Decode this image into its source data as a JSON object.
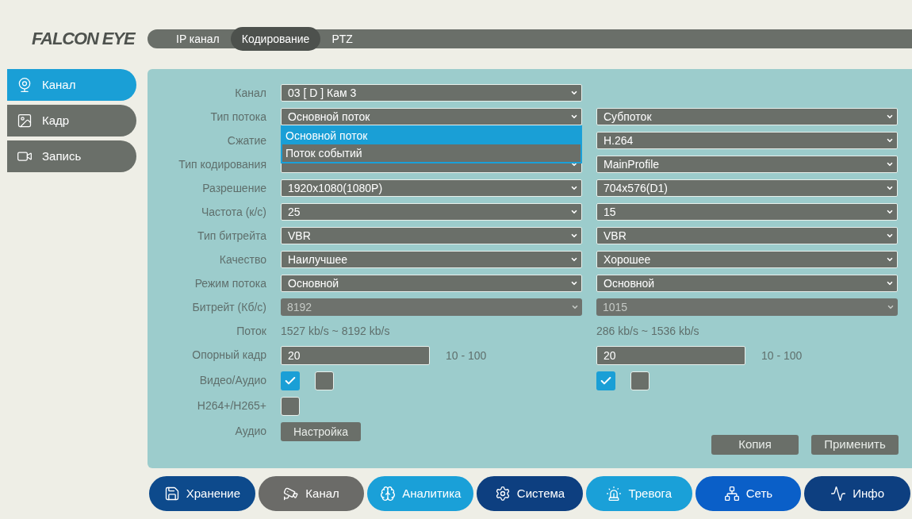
{
  "logo": "FALCON EYE",
  "top_tabs": [
    {
      "label": "IP канал",
      "selected": false
    },
    {
      "label": "Кодирование",
      "selected": true
    },
    {
      "label": "PTZ",
      "selected": false
    }
  ],
  "sidebar": [
    {
      "label": "Канал",
      "selected": true
    },
    {
      "label": "Кадр",
      "selected": false
    },
    {
      "label": "Запись",
      "selected": false
    }
  ],
  "rows": [
    {
      "label": "Канал",
      "left": {
        "kind": "select",
        "value": "03 [ D ] Кам 3",
        "disabled": false
      }
    },
    {
      "label": "Тип потока",
      "left": {
        "kind": "select",
        "value": "Основной поток",
        "disabled": false,
        "expanded": true,
        "options": [
          {
            "label": "Основной поток",
            "selected": true
          },
          {
            "label": "Поток событий",
            "selected": false
          }
        ]
      },
      "right": {
        "kind": "select",
        "value": "Субпоток",
        "disabled": false
      }
    },
    {
      "label": "Сжатие",
      "right": {
        "kind": "select",
        "value": "H.264",
        "disabled": false
      }
    },
    {
      "label": "Тип кодирования",
      "left": {
        "kind": "select",
        "disabled": false
      },
      "right": {
        "kind": "select",
        "value": "MainProfile",
        "disabled": false
      }
    },
    {
      "label": "Разрешение",
      "left": {
        "kind": "select",
        "value": "1920x1080(1080P)",
        "disabled": false
      },
      "right": {
        "kind": "select",
        "value": "704x576(D1)",
        "disabled": false
      }
    },
    {
      "label": "Частота (к/с)",
      "left": {
        "kind": "select",
        "value": "25",
        "disabled": false
      },
      "right": {
        "kind": "select",
        "value": "15",
        "disabled": false
      }
    },
    {
      "label": "Тип битрейта",
      "left": {
        "kind": "select",
        "value": "VBR",
        "disabled": false
      },
      "right": {
        "kind": "select",
        "value": "VBR",
        "disabled": false
      }
    },
    {
      "label": "Качество",
      "left": {
        "kind": "select",
        "value": "Наилучшее",
        "disabled": false
      },
      "right": {
        "kind": "select",
        "value": "Хорошее",
        "disabled": false
      }
    },
    {
      "label": "Режим потока",
      "left": {
        "kind": "select",
        "value": "Основной",
        "disabled": false
      },
      "right": {
        "kind": "select",
        "value": "Основной",
        "disabled": false
      }
    },
    {
      "label": "Битрейт (Кб/с)",
      "left": {
        "kind": "select",
        "value": "8192",
        "disabled": true
      },
      "right": {
        "kind": "select",
        "value": "1015",
        "disabled": true
      }
    },
    {
      "label": "Поток",
      "left": {
        "kind": "text",
        "value": "1527 kb/s ~ 8192 kb/s"
      },
      "right": {
        "kind": "text",
        "value": "286 kb/s ~ 1536 kb/s"
      }
    },
    {
      "label": "Опорный кадр",
      "left": {
        "kind": "input",
        "value": "20",
        "range": "10 - 100"
      },
      "right": {
        "kind": "input",
        "value": "20",
        "range": "10 - 100"
      }
    },
    {
      "label": "Видео/Аудио",
      "left": {
        "kind": "checks",
        "items": [
          {
            "checked": true
          },
          {
            "checked": false
          }
        ]
      },
      "right": {
        "kind": "checks",
        "items": [
          {
            "checked": true
          },
          {
            "checked": false
          }
        ]
      }
    },
    {
      "label": "H264+/H265+",
      "left": {
        "kind": "checks",
        "items": [
          {
            "checked": false
          }
        ]
      }
    },
    {
      "label": "Аудио",
      "left": {
        "kind": "button",
        "value": "Настройка"
      }
    }
  ],
  "actions": [
    "Копия",
    "Применить"
  ],
  "bottom_nav": [
    {
      "label": "Хранение",
      "color": "#0d4a8c"
    },
    {
      "label": "Канал",
      "color": "#6b6b68"
    },
    {
      "label": "Аналитика",
      "color": "#1aa0d8"
    },
    {
      "label": "Система",
      "color": "#0d3f80"
    },
    {
      "label": "Тревога",
      "color": "#1aa0d8"
    },
    {
      "label": "Сеть",
      "color": "#0a5fc8"
    },
    {
      "label": "Инфо",
      "color": "#0d3f80"
    }
  ]
}
